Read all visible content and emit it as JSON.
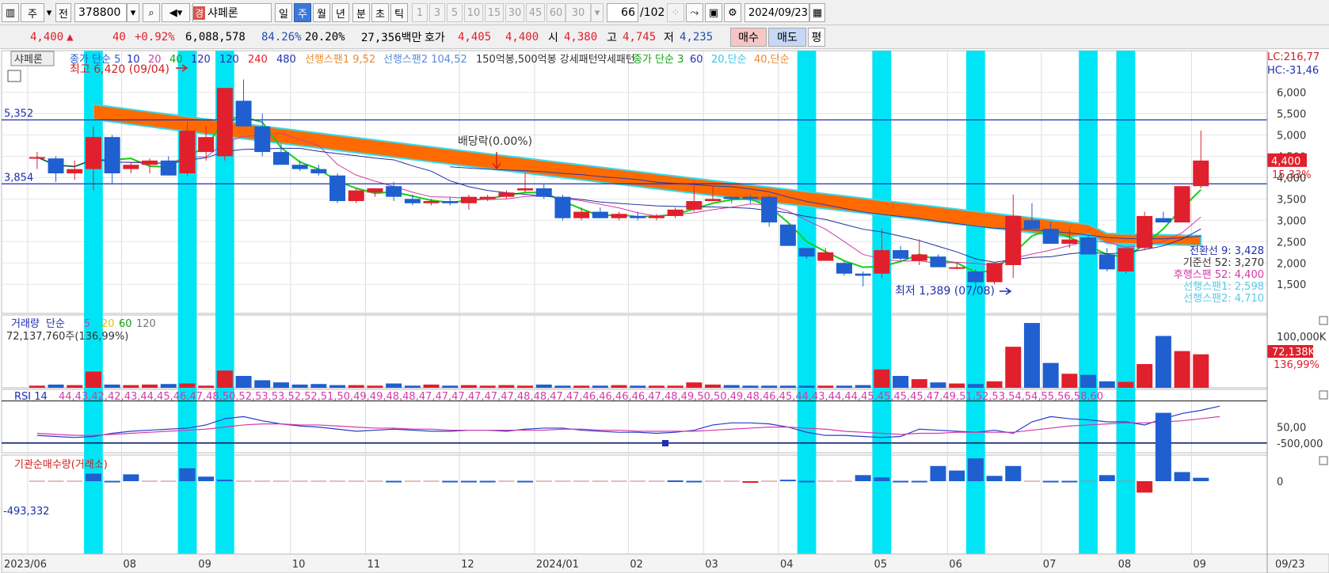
{
  "toolbar": {
    "market_btn": "주",
    "prev_btn": "전",
    "code": "378800",
    "badge": "경",
    "name": "샤페론",
    "periods": [
      "일",
      "주",
      "월",
      "년",
      "분",
      "초",
      "틱"
    ],
    "active_period": "주",
    "intervals": [
      "1",
      "3",
      "5",
      "10",
      "15",
      "30",
      "45",
      "60"
    ],
    "interval_select": "30",
    "bar_count": "66",
    "bar_total": "/102",
    "date": "2024/09/23"
  },
  "quote": {
    "price": "4,400",
    "arrow": "▲",
    "change": "40",
    "pct": "+0.92%",
    "volume": "6,088,578",
    "v1": "84.26%",
    "v2": "20.20%",
    "amount": "27,356백만",
    "hoga_label": "호가",
    "ask": "4,405",
    "bid": "4,400",
    "open_label": "시",
    "open": "4,380",
    "high_label": "고",
    "high": "4,745",
    "low_label": "저",
    "low": "4,235",
    "buy_btn": "매수",
    "sell_btn": "매도",
    "eval_btn": "평"
  },
  "colors": {
    "up": "#e0202c",
    "down": "#1f5fcf",
    "cloud": "#ff6a00",
    "highlight": "#00e5f5"
  },
  "chart_data": [
    {
      "type": "candlestick",
      "name": "price",
      "period": "weekly",
      "y_ticks": [
        1500,
        2000,
        2500,
        3000,
        3500,
        4000,
        4500,
        5000,
        5500,
        6000
      ],
      "x_ticks": [
        "2023/06",
        "08",
        "09",
        "10",
        "11",
        "12",
        "2024/01",
        "02",
        "03",
        "04",
        "05",
        "06",
        "07",
        "08",
        "09"
      ],
      "x_end_label": "09/23",
      "ohlc": [
        [
          4450,
          4600,
          4200,
          4480
        ],
        [
          4450,
          4500,
          3900,
          4100
        ],
        [
          4100,
          4400,
          3950,
          4200
        ],
        [
          4200,
          5200,
          3700,
          4950
        ],
        [
          4950,
          5000,
          3850,
          4100
        ],
        [
          4200,
          4350,
          4100,
          4300
        ],
        [
          4300,
          4450,
          4100,
          4400
        ],
        [
          4400,
          4500,
          4050,
          4050
        ],
        [
          4100,
          5300,
          4050,
          5100
        ],
        [
          4600,
          5200,
          4400,
          4950
        ],
        [
          4500,
          6100,
          4400,
          6100
        ],
        [
          5800,
          6300,
          5200,
          5200
        ],
        [
          5200,
          5500,
          4500,
          4600
        ],
        [
          4600,
          4800,
          4300,
          4300
        ],
        [
          4300,
          4400,
          4150,
          4200
        ],
        [
          4200,
          4300,
          4050,
          4100
        ],
        [
          4050,
          4100,
          3400,
          3450
        ],
        [
          3450,
          3750,
          3400,
          3700
        ],
        [
          3650,
          3750,
          3550,
          3750
        ],
        [
          3800,
          3900,
          3450,
          3550
        ],
        [
          3500,
          3600,
          3350,
          3400
        ],
        [
          3400,
          3500,
          3350,
          3450
        ],
        [
          3450,
          3550,
          3350,
          3400
        ],
        [
          3400,
          3600,
          3250,
          3550
        ],
        [
          3500,
          3600,
          3450,
          3550
        ],
        [
          3550,
          3700,
          3500,
          3650
        ],
        [
          3700,
          4100,
          3650,
          3750
        ],
        [
          3750,
          3850,
          3500,
          3550
        ],
        [
          3550,
          3600,
          3000,
          3050
        ],
        [
          3050,
          3300,
          3000,
          3200
        ],
        [
          3200,
          3300,
          3050,
          3050
        ],
        [
          3050,
          3200,
          3000,
          3150
        ],
        [
          3100,
          3200,
          3000,
          3050
        ],
        [
          3050,
          3150,
          3000,
          3100
        ],
        [
          3100,
          3300,
          3050,
          3250
        ],
        [
          3250,
          3900,
          3200,
          3450
        ],
        [
          3450,
          3800,
          3450,
          3500
        ],
        [
          3550,
          3550,
          3400,
          3500
        ],
        [
          3550,
          3600,
          3400,
          3500
        ],
        [
          3550,
          3600,
          2850,
          2950
        ],
        [
          2900,
          2900,
          2400,
          2400
        ],
        [
          2350,
          2350,
          2100,
          2150
        ],
        [
          2050,
          2350,
          2050,
          2250
        ],
        [
          2000,
          2050,
          1700,
          1750
        ],
        [
          1750,
          1800,
          1450,
          1700
        ],
        [
          1750,
          2800,
          1650,
          2300
        ],
        [
          2300,
          2400,
          2050,
          2100
        ],
        [
          2050,
          2550,
          1950,
          2200
        ],
        [
          2150,
          2200,
          1950,
          1900
        ],
        [
          1900,
          2000,
          1850,
          1900
        ],
        [
          1800,
          1850,
          1400,
          1550
        ],
        [
          1550,
          2000,
          1500,
          2000
        ],
        [
          1950,
          3600,
          1650,
          3100
        ],
        [
          3000,
          3400,
          2800,
          2800
        ],
        [
          2800,
          2950,
          2550,
          2450
        ],
        [
          2450,
          2800,
          2350,
          2550
        ],
        [
          2600,
          2650,
          2200,
          2200
        ],
        [
          2200,
          2350,
          1800,
          1850
        ],
        [
          1800,
          2300,
          1750,
          2350
        ],
        [
          2350,
          3200,
          2300,
          3100
        ],
        [
          3050,
          3200,
          2950,
          2950
        ],
        [
          2950,
          3700,
          2950,
          3800
        ],
        [
          3800,
          5100,
          3750,
          4400
        ]
      ],
      "highlight_bars": [
        3,
        8,
        10,
        41,
        45,
        50,
        56,
        58
      ],
      "hlines": [
        {
          "label": "5,352",
          "value": 5352
        },
        {
          "label": "3,854",
          "value": 3854
        }
      ],
      "annotations": {
        "high": "최고 6,420 (09/04)",
        "low": "최저 1,389 (07/08)",
        "dividend": "배당락(0.00%)"
      },
      "legend": [
        "종가 단순 5",
        "10",
        "20",
        "40",
        "120",
        "120",
        "240",
        "480",
        "선행스팬1 9,52",
        "선행스팬2 104,52",
        "150억봉,500억봉 강세패턴",
        "약세패턴",
        "종가 단순 3",
        "60",
        "20,단순",
        "40,단순"
      ],
      "right_labels": {
        "lc": "LC:216,77",
        "hc": "HC:-31,46",
        "price": "4,400",
        "pct": "15,33%"
      },
      "ichimoku_labels": [
        "전환선 9: 3,428",
        "기준선 52: 3,270",
        "후행스팬 52: 4,400",
        "선행스팬1: 2,598",
        "선행스팬2: 4,710"
      ]
    },
    {
      "type": "bar",
      "name": "volume",
      "title": "거래량",
      "legend": [
        "단순",
        "5",
        "20",
        "60",
        "120"
      ],
      "readout": "72,137,760주(136,99%)",
      "values": [
        200,
        300,
        250,
        1500,
        300,
        250,
        300,
        350,
        400,
        200,
        1600,
        1100,
        700,
        500,
        300,
        350,
        250,
        250,
        200,
        400,
        200,
        300,
        200,
        250,
        200,
        250,
        200,
        300,
        200,
        200,
        200,
        250,
        200,
        200,
        200,
        500,
        300,
        250,
        200,
        200,
        200,
        200,
        200,
        200,
        250,
        1700,
        1100,
        800,
        500,
        400,
        350,
        600,
        3800,
        6000,
        2300,
        1300,
        1200,
        600,
        550,
        2200,
        4800,
        3400,
        3100
      ],
      "y_tick": "100,000K",
      "right_value": "72,138K",
      "right_pct": "136,99%"
    },
    {
      "type": "line",
      "name": "rsi",
      "title": "RSI 14",
      "signal": [
        44,
        43,
        42,
        42,
        43,
        44,
        45,
        46,
        47,
        48,
        50,
        52,
        53,
        53,
        52,
        52,
        51,
        50,
        49,
        49,
        48,
        48,
        47,
        47,
        47,
        47,
        47,
        47,
        48,
        48,
        47,
        47,
        46,
        46,
        46,
        46,
        47,
        48,
        49,
        50,
        50,
        49,
        48,
        46,
        45,
        44,
        43,
        44,
        44,
        45,
        45,
        45,
        45,
        47,
        49,
        51,
        52,
        53,
        54,
        54,
        55,
        56,
        58,
        60
      ],
      "y_tick": "50,00",
      "rsi": [
        42,
        41,
        40,
        41,
        44,
        46,
        47,
        48,
        49,
        52,
        58,
        60,
        56,
        53,
        51,
        50,
        48,
        46,
        47,
        48,
        47,
        46,
        46,
        47,
        47,
        46,
        48,
        49,
        49,
        47,
        46,
        45,
        45,
        44,
        45,
        47,
        52,
        54,
        54,
        53,
        50,
        45,
        42,
        42,
        41,
        40,
        41,
        48,
        47,
        46,
        45,
        47,
        44,
        55,
        60,
        58,
        57,
        55,
        55,
        52,
        58,
        63,
        66,
        70
      ]
    },
    {
      "type": "bar",
      "name": "institution_net",
      "title": "기관순매수량(거래소)",
      "readout": "-493,332",
      "y_ticks": [
        "0",
        "-500,000"
      ],
      "values": [
        0,
        0,
        0,
        -100000,
        -5000,
        -90000,
        0,
        0,
        -170000,
        -60000,
        -20000,
        0,
        0,
        0,
        0,
        0,
        0,
        0,
        0,
        -5000,
        0,
        0,
        -5000,
        -5000,
        -5000,
        0,
        -5000,
        0,
        0,
        0,
        0,
        0,
        0,
        0,
        -10000,
        -5000,
        0,
        0,
        10000,
        0,
        -20000,
        -5000,
        0,
        0,
        -80000,
        -50000,
        -5000,
        -5000,
        -200000,
        -140000,
        -300000,
        -70000,
        -200000,
        0,
        -5000,
        -5000,
        0,
        -80000,
        0,
        150000,
        -900000,
        -120000,
        -45000,
        0,
        0,
        200000,
        -280000,
        20000,
        -30000,
        -120000
      ],
      "marker": "-493,332"
    }
  ]
}
